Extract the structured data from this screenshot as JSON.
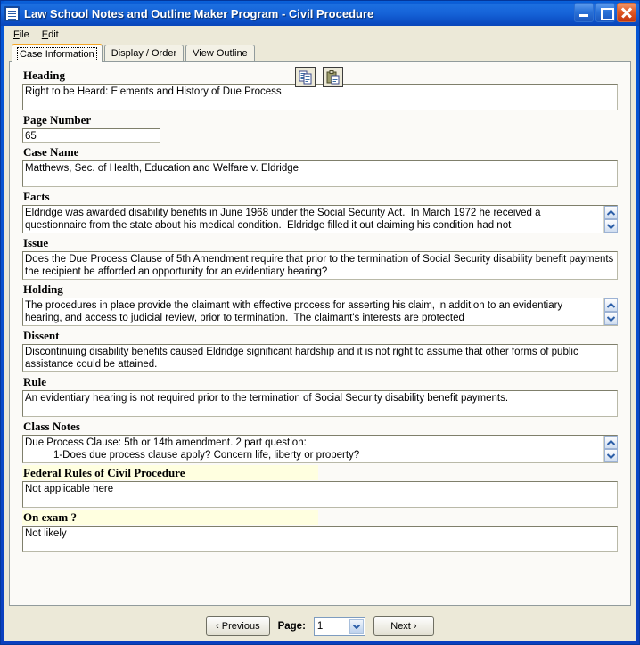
{
  "window": {
    "title": "Law School Notes and Outline Maker Program - Civil Procedure",
    "app_icon": "document-icon",
    "controls": {
      "minimize": "minimize-icon",
      "maximize": "maximize-icon",
      "close": "close-icon"
    }
  },
  "menu": {
    "items": [
      {
        "label": "File",
        "accel": "F"
      },
      {
        "label": "Edit",
        "accel": "E"
      }
    ]
  },
  "tabs": [
    {
      "label": "Case Information",
      "active": true
    },
    {
      "label": "Display / Order",
      "active": false
    },
    {
      "label": "View Outline",
      "active": false
    }
  ],
  "toolbar": {
    "copy_label": "copy-icon",
    "paste_label": "paste-icon"
  },
  "fields": {
    "heading": {
      "label": "Heading",
      "value": "Right to be Heard: Elements and History of Due Process"
    },
    "page_number": {
      "label": "Page Number",
      "value": "65"
    },
    "case_name": {
      "label": "Case Name",
      "value": "Matthews, Sec. of Health, Education and Welfare v. Eldridge"
    },
    "facts": {
      "label": "Facts",
      "value": "Eldridge was awarded disability benefits in June 1968 under the Social Security Act.  In March 1972 he received a questionnaire from the state about his medical condition.  Eldridge filled it out claiming his condition had not"
    },
    "issue": {
      "label": "Issue",
      "value": "Does the Due Process Clause of 5th Amendment require that prior to the termination of Social Security disability benefit payments the recipient be afforded an opportunity for an evidentiary hearing?"
    },
    "holding": {
      "label": "Holding",
      "value": "The procedures in place provide the claimant with effective process for asserting his claim, in addition to an evidentiary hearing, and access to judicial review, prior to termination.  The claimant's interests are protected"
    },
    "dissent": {
      "label": "Dissent",
      "value": "Discontinuing disability benefits caused Eldridge significant hardship and it is not right to assume that other forms of public assistance could be attained."
    },
    "rule": {
      "label": "Rule",
      "value": "An evidentiary hearing is not required prior to the termination of Social Security disability benefit payments."
    },
    "class_notes": {
      "label": "Class Notes",
      "value": "Due Process Clause: 5th or 14th amendment. 2 part question:\n          1-Does due process clause apply? Concern life, liberty or property?"
    },
    "federal_rules": {
      "label": "Federal Rules of Civil Procedure",
      "value": "Not applicable here",
      "highlight": "#FFFFE0"
    },
    "on_exam": {
      "label": "On exam ?",
      "value": "Not likely",
      "highlight": "#FFFFE0"
    }
  },
  "footer": {
    "previous_label": "‹ Previous",
    "page_label": "Page:",
    "page_value": "1",
    "next_label": "Next ›"
  },
  "colors": {
    "titlebar_blue": "#0A52CF",
    "client_beige": "#ECE9D8",
    "panel_bg": "#FBFAF7",
    "tab_active_accent": "#F5A623",
    "label_highlight": "#FFFFE0"
  }
}
